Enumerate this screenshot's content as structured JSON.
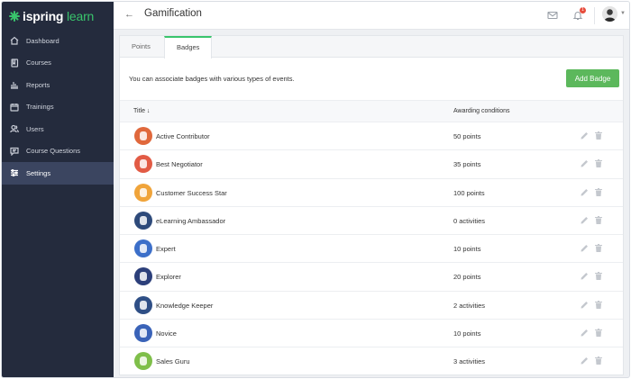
{
  "app": {
    "logo_main": "ispring",
    "logo_accent": "learn",
    "page_title": "Gamification",
    "notification_count": "1"
  },
  "sidebar": {
    "items": [
      {
        "label": "Dashboard",
        "icon": "home-icon"
      },
      {
        "label": "Courses",
        "icon": "book-icon"
      },
      {
        "label": "Reports",
        "icon": "bar-chart-icon"
      },
      {
        "label": "Trainings",
        "icon": "calendar-icon"
      },
      {
        "label": "Users",
        "icon": "users-icon"
      },
      {
        "label": "Course Questions",
        "icon": "chat-icon"
      },
      {
        "label": "Settings",
        "icon": "sliders-icon"
      }
    ],
    "active_index": 6
  },
  "tabs": {
    "points": "Points",
    "badges": "Badges",
    "active": "badges"
  },
  "main": {
    "description": "You can associate badges with various types of events.",
    "add_button": "Add Badge"
  },
  "table": {
    "columns": {
      "title": "Title ↓",
      "conditions": "Awarding conditions"
    },
    "rows": [
      {
        "title": "Active Contributor",
        "condition": "50 points",
        "color": "#e0683c"
      },
      {
        "title": "Best Negotiator",
        "condition": "35 points",
        "color": "#e25b45"
      },
      {
        "title": "Customer Success Star",
        "condition": "100 points",
        "color": "#f0a43a"
      },
      {
        "title": "eLearning Ambassador",
        "condition": "0 activities",
        "color": "#2e4a7a"
      },
      {
        "title": "Expert",
        "condition": "10 points",
        "color": "#3c6fc9"
      },
      {
        "title": "Explorer",
        "condition": "20 points",
        "color": "#2c3f7a"
      },
      {
        "title": "Knowledge Keeper",
        "condition": "2 activities",
        "color": "#2f4f86"
      },
      {
        "title": "Novice",
        "condition": "10 points",
        "color": "#3a63b8"
      },
      {
        "title": "Sales Guru",
        "condition": "3 activities",
        "color": "#7fbf4a"
      }
    ]
  }
}
